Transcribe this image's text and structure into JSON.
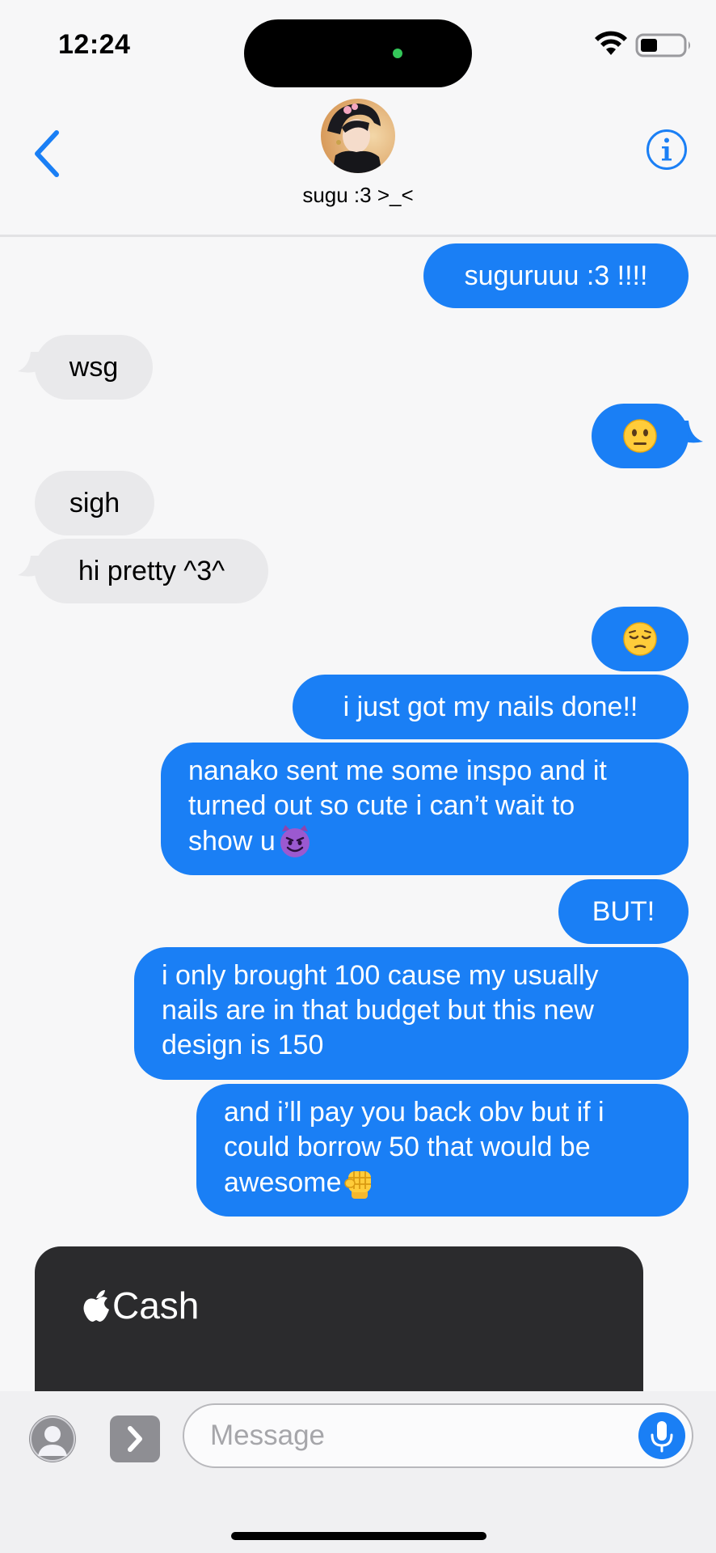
{
  "status_bar": {
    "time": "12:24",
    "battery_level": 0.4
  },
  "header": {
    "contact_name": "sugu :3 >_<",
    "back_icon": "chevron-left-icon",
    "info_icon": "info-circle-icon"
  },
  "messages": [
    {
      "from": "me",
      "text": "suguruuu :3 !!!!"
    },
    {
      "from": "them",
      "text": "wsg"
    },
    {
      "from": "me",
      "emoji": "neutral-face"
    },
    {
      "from": "them",
      "text": "sigh"
    },
    {
      "from": "them",
      "text": "hi pretty ^3^"
    },
    {
      "from": "me",
      "emoji": "pensive-face"
    },
    {
      "from": "me",
      "text": "i just got my nails done!!"
    },
    {
      "from": "me",
      "lines": [
        "nanako sent me some inspo and it",
        "turned out so cute i can’t wait to",
        "show u"
      ],
      "trailing_emoji": "smiling-imp"
    },
    {
      "from": "me",
      "text": "BUT!"
    },
    {
      "from": "me",
      "lines": [
        "i only brought 100 cause my usually",
        "nails are in that budget but this new",
        "design is 150"
      ]
    },
    {
      "from": "me",
      "lines": [
        "and i’ll pay you back obv but if i",
        "could borrow 50 that would be",
        "awesome"
      ],
      "trailing_emoji": "raised-fist"
    }
  ],
  "apple_cash": {
    "label": "Cash",
    "icon": "apple-logo-icon"
  },
  "composer": {
    "placeholder": "Message",
    "value": "",
    "contact_icon": "person-icon",
    "apps_icon": "chevron-right-icon",
    "mic_icon": "microphone-icon"
  },
  "colors": {
    "outgoing": "#1a7ff5",
    "incoming": "#e9e9eb",
    "background": "#f7f7f8",
    "card": "#2b2b2d"
  }
}
